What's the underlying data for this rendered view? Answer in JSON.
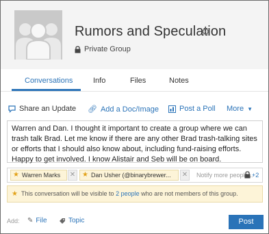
{
  "header": {
    "title": "Rumors and Speculation",
    "privacy": "Private Group"
  },
  "tabs": [
    {
      "label": "Conversations",
      "active": true
    },
    {
      "label": "Info"
    },
    {
      "label": "Files"
    },
    {
      "label": "Notes"
    }
  ],
  "publisher": {
    "share_update": "Share an Update",
    "add_doc": "Add a Doc/Image",
    "post_poll": "Post a Poll",
    "more": "More"
  },
  "composer": {
    "text": "Warren and Dan. I thought it important to create a group where we can trash talk Brad. Let me know if there are any other Brad trash-talking sites or efforts that I should also know about, including fund-raising efforts. Happy to get involved. I know Alistair and Seb will be on board."
  },
  "recipients": {
    "chips": [
      {
        "label": "Warren Marks"
      },
      {
        "label": "Dan Usher (@binarybrewer..."
      }
    ],
    "placeholder": "Notify more people...",
    "extra_count": "+2"
  },
  "notice": {
    "prefix": "This conversation will be visible to ",
    "link": "2 people",
    "suffix": " who are not members of this group."
  },
  "footer": {
    "add_label": "Add:",
    "file": "File",
    "topic": "Topic",
    "post_label": "Post"
  },
  "colors": {
    "accent": "#2a73b8",
    "chip_bg": "#fdf4d8",
    "avatar_bg": "#c9c9c9"
  }
}
